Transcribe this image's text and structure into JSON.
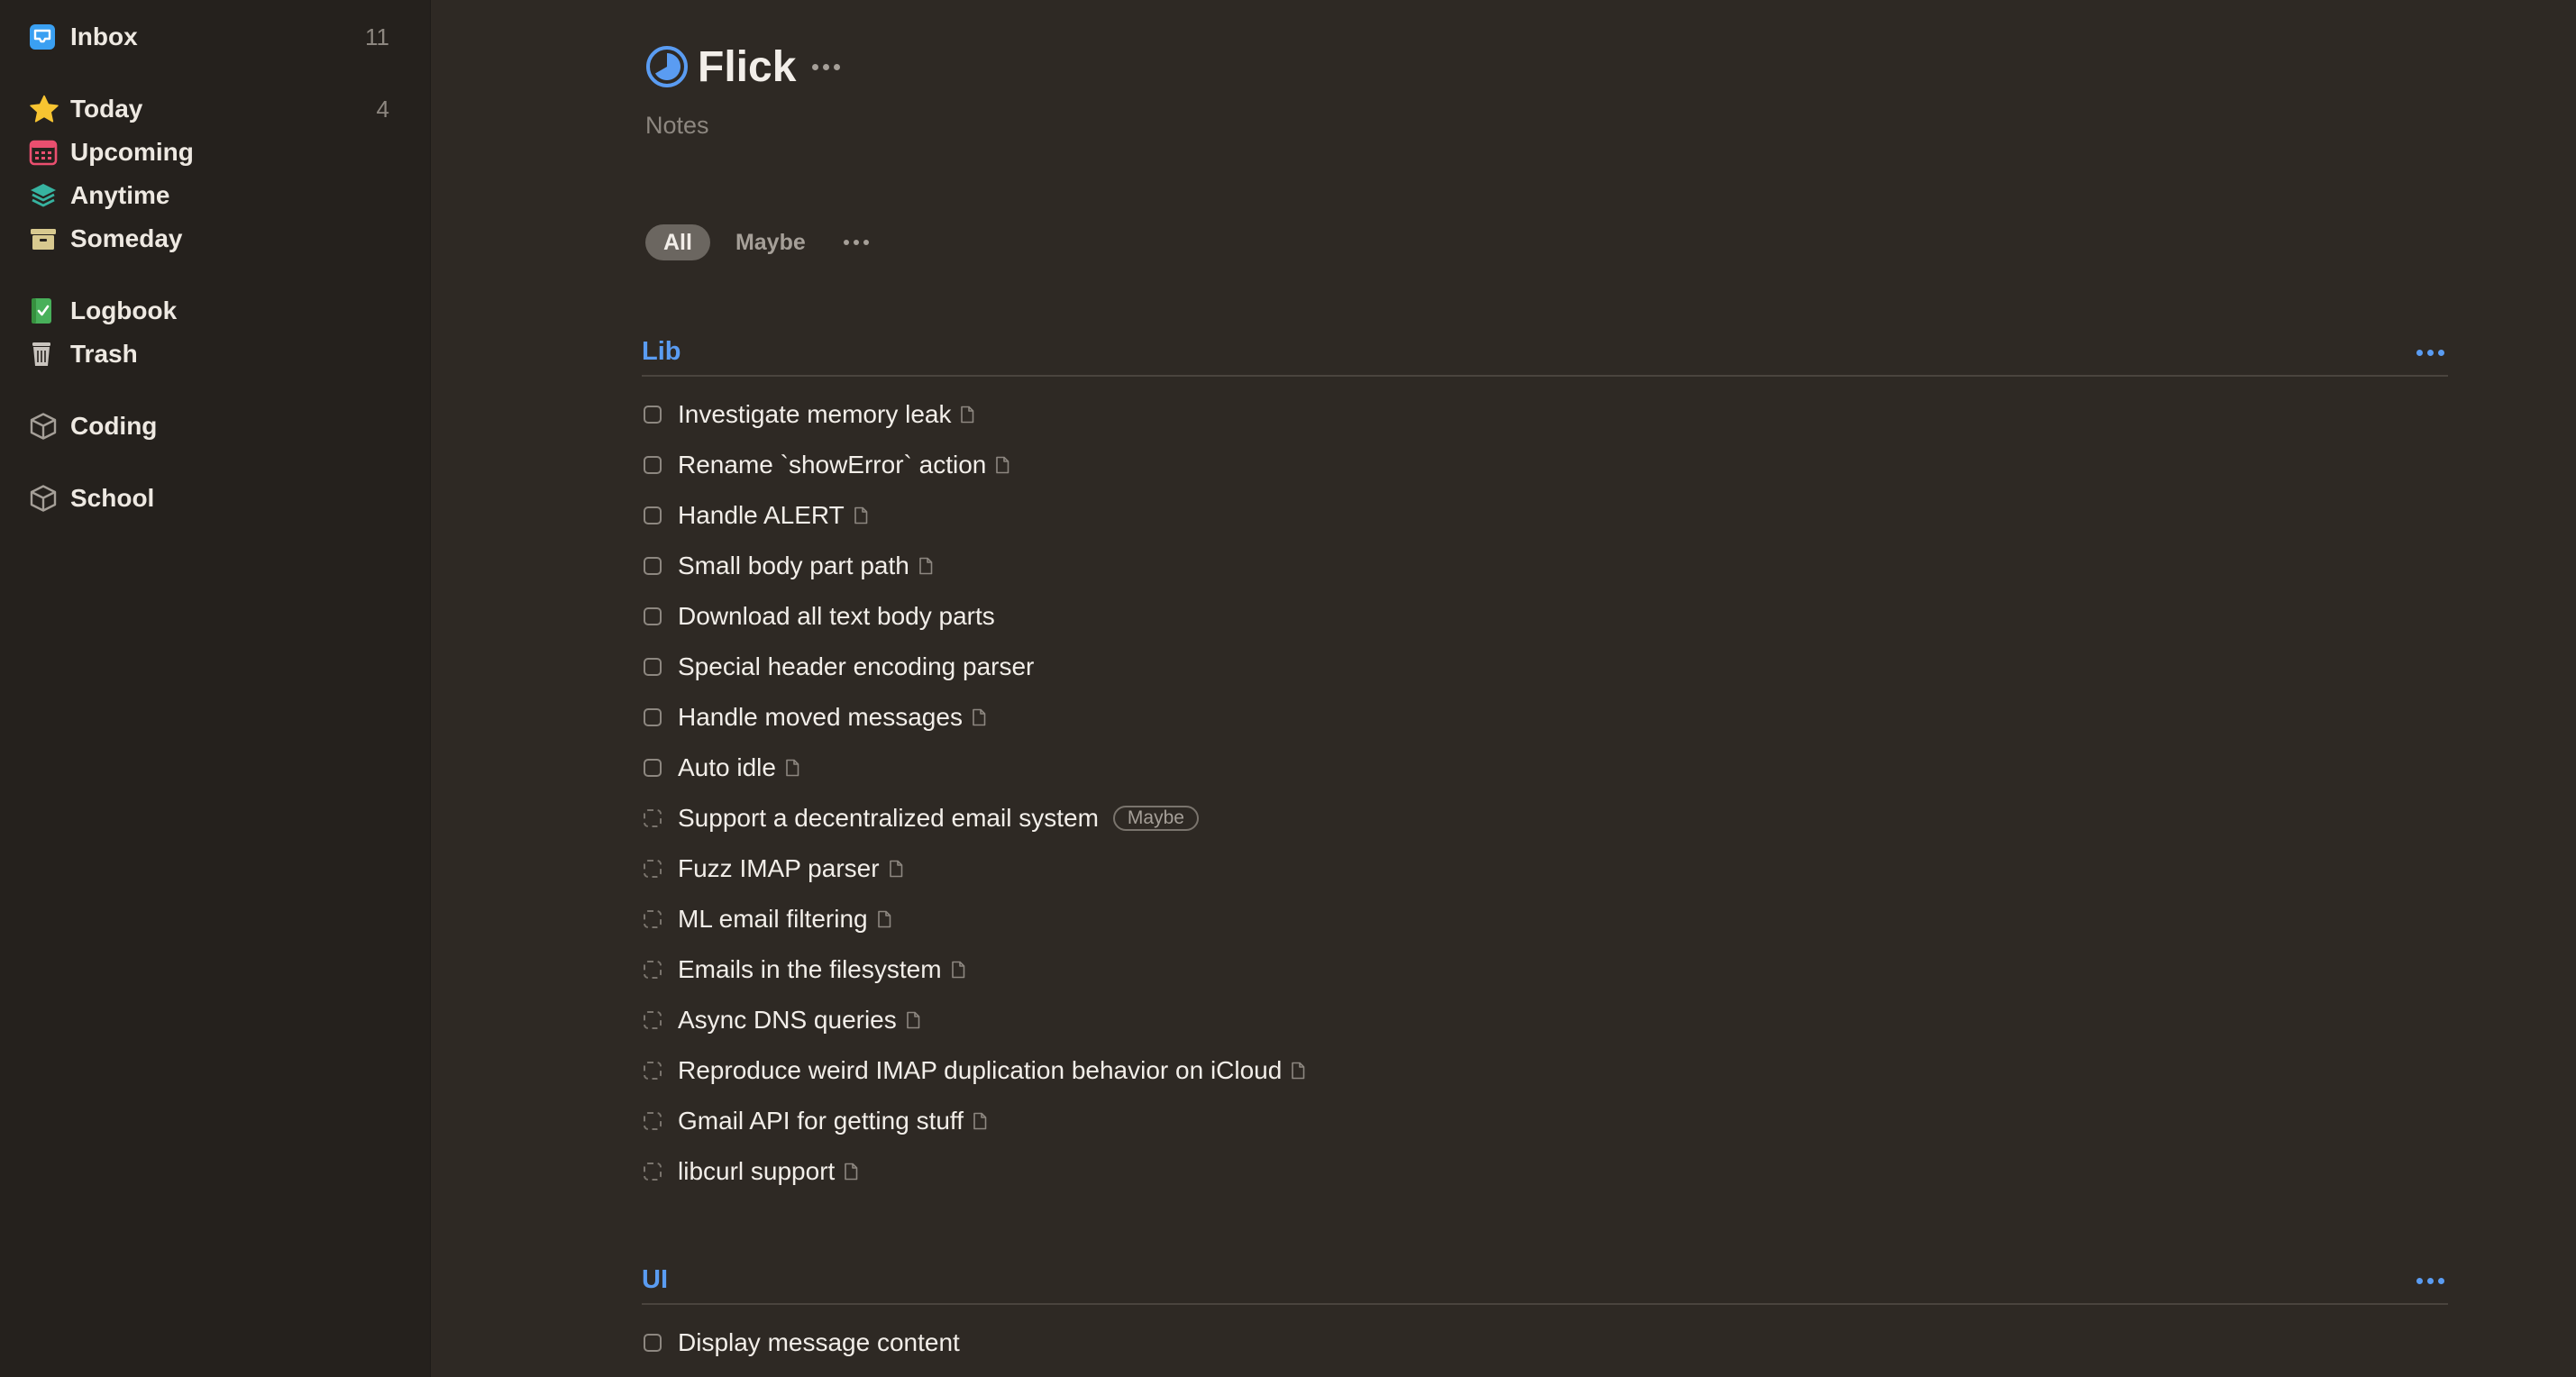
{
  "sidebar": {
    "items": [
      {
        "label": "Inbox",
        "count": "11",
        "icon": "inbox-icon"
      },
      {
        "label": "Today",
        "count": "4",
        "icon": "star-icon"
      },
      {
        "label": "Upcoming",
        "count": "",
        "icon": "calendar-icon"
      },
      {
        "label": "Anytime",
        "count": "",
        "icon": "layers-icon"
      },
      {
        "label": "Someday",
        "count": "",
        "icon": "archive-box-icon"
      },
      {
        "label": "Logbook",
        "count": "",
        "icon": "logbook-icon"
      },
      {
        "label": "Trash",
        "count": "",
        "icon": "trash-icon"
      },
      {
        "label": "Coding",
        "count": "",
        "icon": "area-cube-icon"
      },
      {
        "label": "School",
        "count": "",
        "icon": "area-cube-icon"
      }
    ]
  },
  "project": {
    "title": "Flick",
    "notes": "Notes",
    "icon": "project-progress-icon"
  },
  "filters": {
    "items": [
      {
        "label": "All",
        "active": true
      },
      {
        "label": "Maybe",
        "active": false
      }
    ]
  },
  "headings": [
    {
      "title": "Lib",
      "todos": [
        {
          "title": "Investigate memory leak",
          "someday": false,
          "has_note": true
        },
        {
          "title": "Rename `showError` action",
          "someday": false,
          "has_note": true
        },
        {
          "title": "Handle ALERT",
          "someday": false,
          "has_note": true
        },
        {
          "title": "Small body part path",
          "someday": false,
          "has_note": true
        },
        {
          "title": "Download all text body parts",
          "someday": false,
          "has_note": false
        },
        {
          "title": "Special header encoding parser",
          "someday": false,
          "has_note": false
        },
        {
          "title": "Handle moved messages",
          "someday": false,
          "has_note": true
        },
        {
          "title": "Auto idle",
          "someday": false,
          "has_note": true
        },
        {
          "title": "Support a decentralized email system",
          "someday": true,
          "has_note": false,
          "tag": "Maybe"
        },
        {
          "title": "Fuzz IMAP parser",
          "someday": true,
          "has_note": true
        },
        {
          "title": "ML email filtering",
          "someday": true,
          "has_note": true
        },
        {
          "title": "Emails in the filesystem",
          "someday": true,
          "has_note": true
        },
        {
          "title": "Async DNS queries",
          "someday": true,
          "has_note": true
        },
        {
          "title": "Reproduce weird IMAP duplication behavior on iCloud",
          "someday": true,
          "has_note": true
        },
        {
          "title": "Gmail API for getting stuff",
          "someday": true,
          "has_note": true
        },
        {
          "title": "libcurl support",
          "someday": true,
          "has_note": true
        }
      ]
    },
    {
      "title": "UI",
      "todos": [
        {
          "title": "Display message content",
          "someday": false,
          "has_note": false
        }
      ]
    }
  ],
  "colors": {
    "background": "#2e2924",
    "sidebar": "#25211d",
    "accent": "#5a9cf2",
    "text": "#f2eee9"
  }
}
